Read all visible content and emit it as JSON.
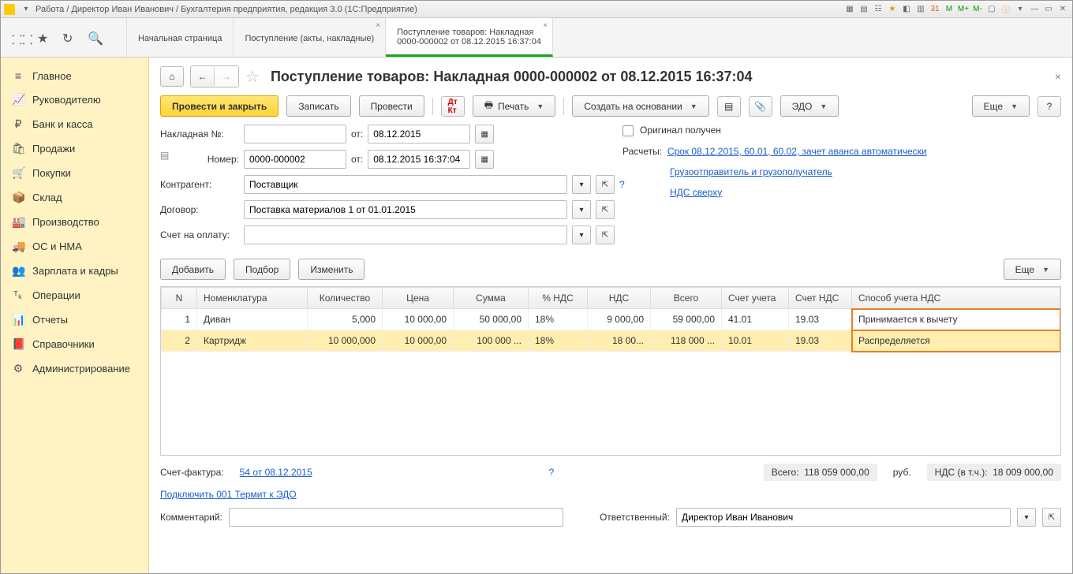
{
  "titlebar": {
    "text": "Работа / Директор Иван Иванович / Бухгалтерия предприятия, редакция 3.0  (1С:Предприятие)"
  },
  "toolbox_icons": [
    "grid-icon",
    "star-icon",
    "history-icon",
    "search-icon"
  ],
  "tabs": [
    {
      "line1": "Начальная страница",
      "line2": ""
    },
    {
      "line1": "Поступление (акты, накладные)",
      "line2": ""
    },
    {
      "line1": "Поступление товаров: Накладная",
      "line2": "0000-000002 от 08.12.2015 16:37:04"
    }
  ],
  "sidebar": [
    {
      "icon": "≡",
      "label": "Главное"
    },
    {
      "icon": "📈",
      "label": "Руководителю"
    },
    {
      "icon": "₽",
      "label": "Банк и касса"
    },
    {
      "icon": "🛍",
      "label": "Продажи"
    },
    {
      "icon": "🛒",
      "label": "Покупки"
    },
    {
      "icon": "📦",
      "label": "Склад"
    },
    {
      "icon": "🏭",
      "label": "Производство"
    },
    {
      "icon": "🚚",
      "label": "ОС и НМА"
    },
    {
      "icon": "👥",
      "label": "Зарплата и кадры"
    },
    {
      "icon": "ᵀₖ",
      "label": "Операции"
    },
    {
      "icon": "📊",
      "label": "Отчеты"
    },
    {
      "icon": "📕",
      "label": "Справочники"
    },
    {
      "icon": "⚙",
      "label": "Администрирование"
    }
  ],
  "page": {
    "title": "Поступление товаров: Накладная 0000-000002 от 08.12.2015 16:37:04",
    "buttons": {
      "post_close": "Провести и закрыть",
      "write": "Записать",
      "post": "Провести",
      "print": "Печать",
      "create_based": "Создать на основании",
      "edo": "ЭДО",
      "more": "Еще"
    },
    "fields": {
      "invoice_label": "Накладная №:",
      "invoice_val": "",
      "from_label": "от:",
      "from1": "08.12.2015",
      "num_label": "Номер:",
      "num_val": "0000-000002",
      "from2": "08.12.2015 16:37:04",
      "kontr_label": "Контрагент:",
      "kontr_val": "Поставщик",
      "dog_label": "Договор:",
      "dog_val": "Поставка материалов 1 от 01.01.2015",
      "pay_label": "Счет на оплату:",
      "pay_val": "",
      "orig_label": "Оригинал получен",
      "rasch_label": "Расчеты:",
      "rasch_link": "Срок 08.12.2015, 60.01, 60.02, зачет аванса автоматически",
      "gruz_link": "Грузоотправитель и грузополучатель",
      "nds_link": "НДС сверху"
    },
    "tblbtns": {
      "add": "Добавить",
      "pick": "Подбор",
      "edit": "Изменить",
      "more": "Еще"
    },
    "columns": [
      "N",
      "Номенклатура",
      "Количество",
      "Цена",
      "Сумма",
      "% НДС",
      "НДС",
      "Всего",
      "Счет учета",
      "Счет НДС",
      "Способ учета НДС"
    ],
    "rows": [
      {
        "n": "1",
        "name": "Диван",
        "qty": "5,000",
        "price": "10 000,00",
        "sum": "50 000,00",
        "vatp": "18%",
        "vat": "9 000,00",
        "total": "59 000,00",
        "acc": "41.01",
        "accvat": "19.03",
        "mode": "Принимается к вычету"
      },
      {
        "n": "2",
        "name": "Картридж",
        "qty": "10 000,000",
        "price": "10 000,00",
        "sum": "100 000 ...",
        "vatp": "18%",
        "vat": "18 00...",
        "total": "118 000 ...",
        "acc": "10.01",
        "accvat": "19.03",
        "mode": "Распределяется"
      }
    ],
    "footer": {
      "sf_label": "Счет-фактура:",
      "sf_link": "54 от 08.12.2015",
      "edo_link": "Подключить 001 Термит к ЭДО",
      "totals_label": "Всего:",
      "totals_val": "118 059 000,00",
      "cur": "руб.",
      "vat_label": "НДС (в т.ч.):",
      "vat_val": "18 009 000,00",
      "cmt_label": "Комментарий:",
      "cmt_val": "",
      "resp_label": "Ответственный:",
      "resp_val": "Директор Иван Иванович"
    }
  }
}
